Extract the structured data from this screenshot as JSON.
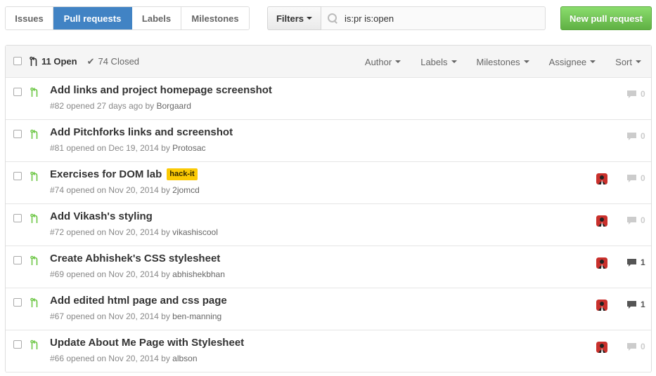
{
  "nav": {
    "tabs": [
      {
        "label": "Issues",
        "active": false
      },
      {
        "label": "Pull requests",
        "active": true
      },
      {
        "label": "Labels",
        "active": false
      },
      {
        "label": "Milestones",
        "active": false
      }
    ]
  },
  "filters": {
    "button_label": "Filters",
    "search_value": "is:pr is:open"
  },
  "new_pr_label": "New pull request",
  "header": {
    "open_label": "11 Open",
    "closed_label": "74 Closed",
    "filter_menus": [
      "Author",
      "Labels",
      "Milestones",
      "Assignee",
      "Sort"
    ]
  },
  "colors": {
    "accent": "#4183c4",
    "open_green": "#6cc644",
    "label_yellow": "#fbca04",
    "new_button": "#60b044"
  },
  "pull_requests": [
    {
      "title": "Add links and project homepage screenshot",
      "number": "#82",
      "opened": "opened 27 days ago by",
      "author": "Borgaard",
      "label": "",
      "has_avatar": false,
      "comments": "0"
    },
    {
      "title": "Add Pitchforks links and screenshot",
      "number": "#81",
      "opened": "opened on Dec 19, 2014 by",
      "author": "Protosac",
      "label": "",
      "has_avatar": false,
      "comments": "0"
    },
    {
      "title": "Exercises for DOM lab",
      "number": "#74",
      "opened": "opened on Nov 20, 2014 by",
      "author": "2jomcd",
      "label": "hack-it",
      "has_avatar": true,
      "comments": "0"
    },
    {
      "title": "Add Vikash's styling",
      "number": "#72",
      "opened": "opened on Nov 20, 2014 by",
      "author": "vikashiscool",
      "label": "",
      "has_avatar": true,
      "comments": "0"
    },
    {
      "title": "Create Abhishek's CSS stylesheet",
      "number": "#69",
      "opened": "opened on Nov 20, 2014 by",
      "author": "abhishekbhan",
      "label": "",
      "has_avatar": true,
      "comments": "1"
    },
    {
      "title": "Add edited html page and css page",
      "number": "#67",
      "opened": "opened on Nov 20, 2014 by",
      "author": "ben-manning",
      "label": "",
      "has_avatar": true,
      "comments": "1"
    },
    {
      "title": "Update About Me Page with Stylesheet",
      "number": "#66",
      "opened": "opened on Nov 20, 2014 by",
      "author": "albson",
      "label": "",
      "has_avatar": true,
      "comments": "0"
    }
  ]
}
